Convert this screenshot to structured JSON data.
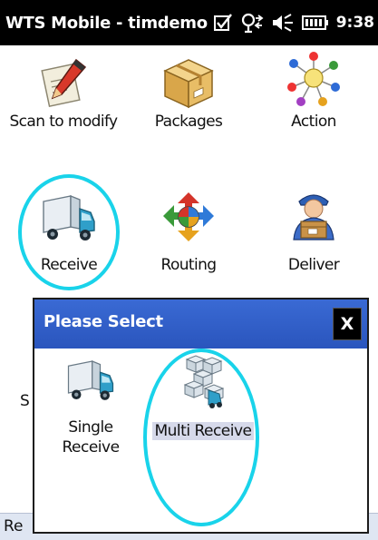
{
  "window": {
    "title": "WTS Mobile - timdemo",
    "time": "9:38"
  },
  "tray_icons": [
    "checkbox-icon",
    "connectivity-icon",
    "volume-icon",
    "battery-icon"
  ],
  "tiles": [
    {
      "label": "Scan to modify",
      "icon": "pencil-scan-icon"
    },
    {
      "label": "Packages",
      "icon": "package-box-icon"
    },
    {
      "label": "Action",
      "icon": "action-molecule-icon"
    },
    {
      "label": "Receive",
      "icon": "truck-icon"
    },
    {
      "label": "Routing",
      "icon": "routing-arrows-icon"
    },
    {
      "label": "Deliver",
      "icon": "delivery-person-icon"
    }
  ],
  "background_peek": {
    "left_fragment": "S",
    "status_fragment": "Re"
  },
  "dialog": {
    "title": "Please Select",
    "close_label": "X",
    "options": [
      {
        "line1": "Single",
        "line2": "Receive",
        "icon": "truck-icon"
      },
      {
        "label": "Multi Receive",
        "icon": "multi-package-icon",
        "selected": true
      }
    ]
  },
  "colors": {
    "titlebar": "#000000",
    "dialog_header": "#2f5ec7",
    "highlight_ring": "#19d3ea",
    "selection": "#d6d9ea"
  }
}
